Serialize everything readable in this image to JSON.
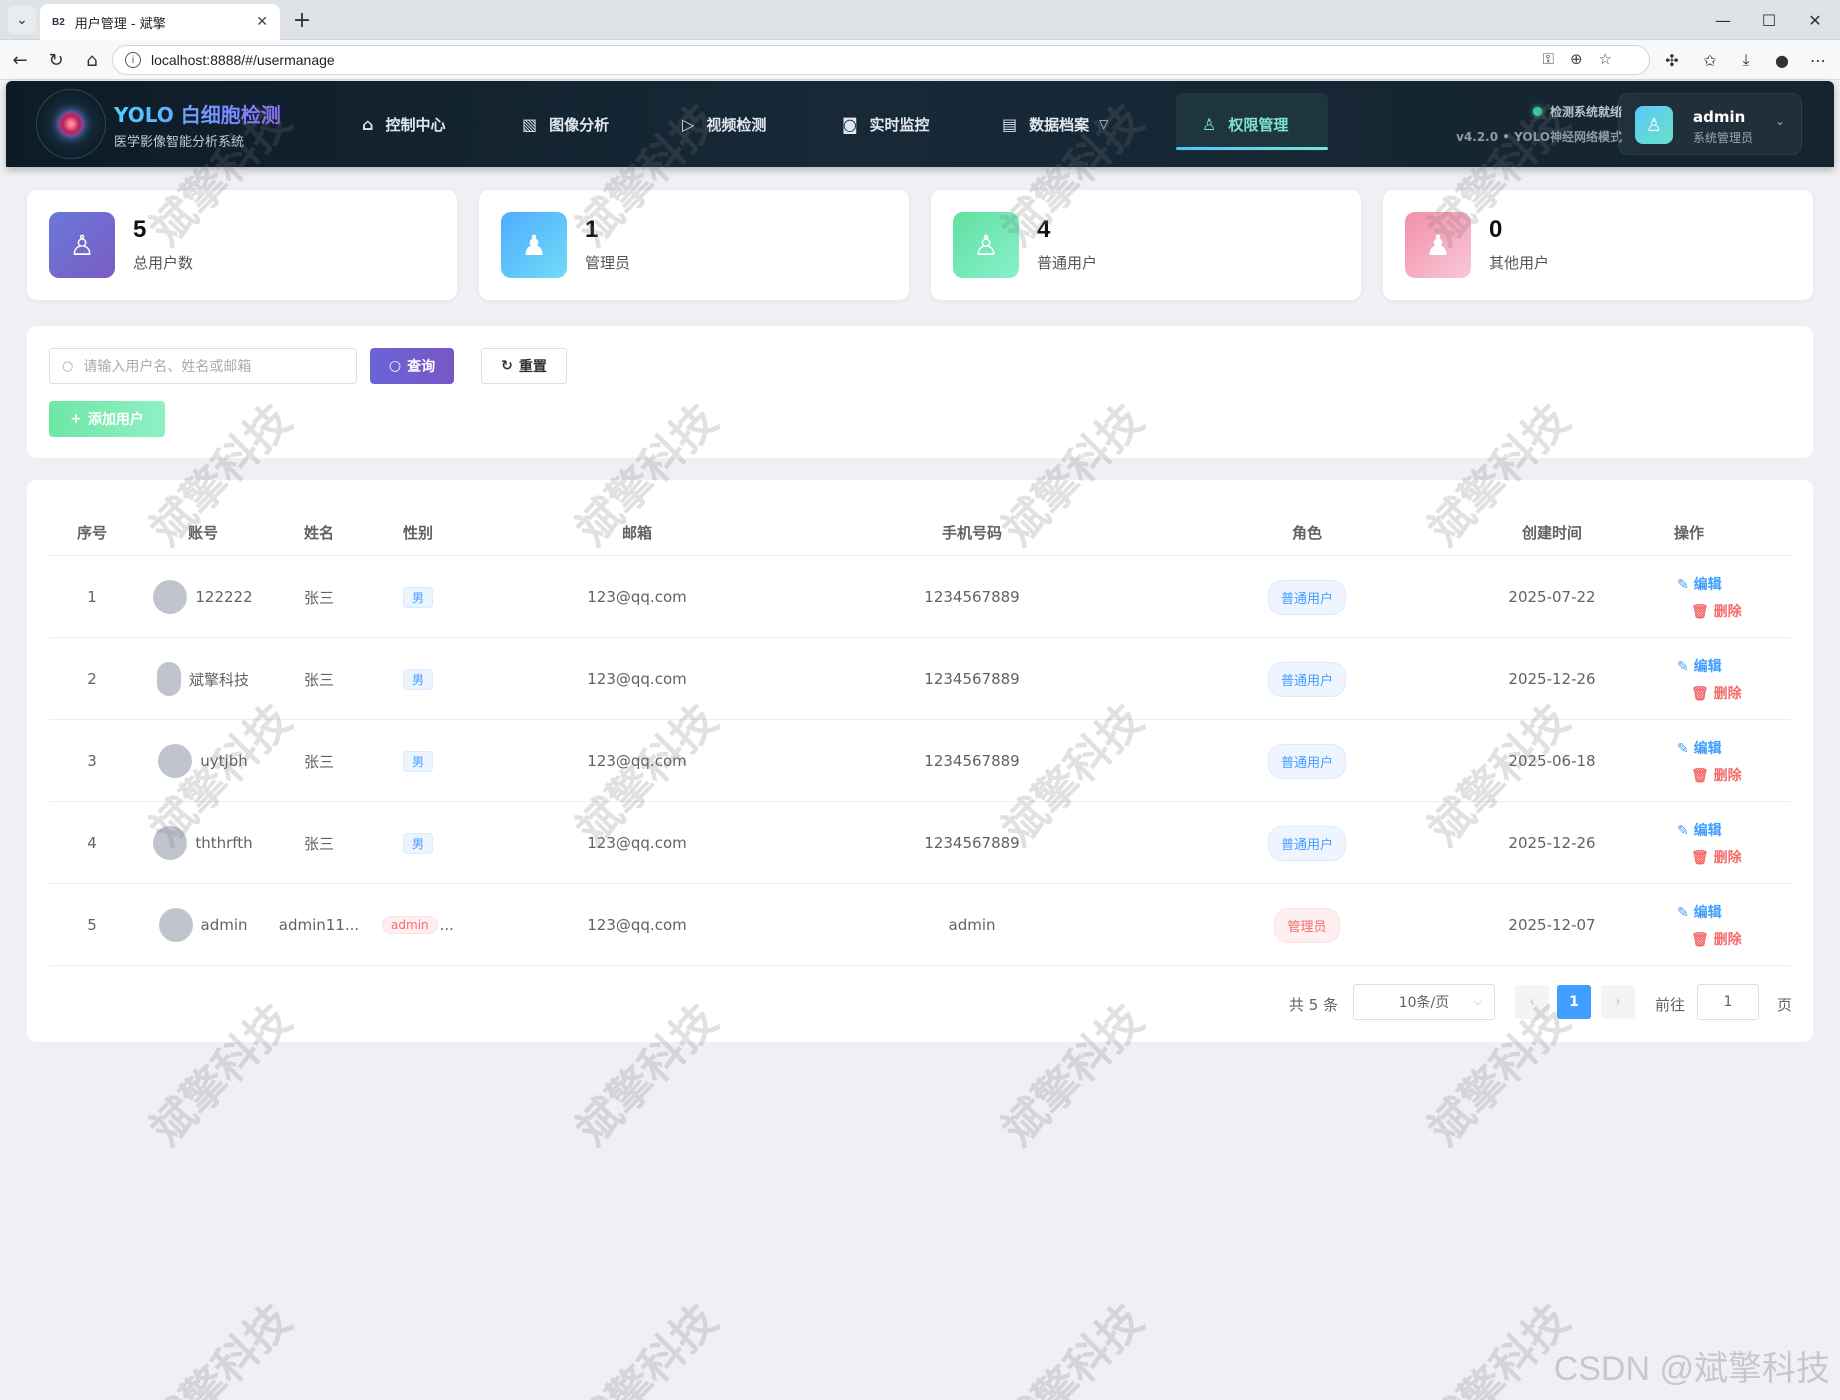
{
  "browser": {
    "tab_title": "用户管理 - 斌擎",
    "tab_favicon": "B2",
    "url": "localhost:8888/#/usermanage"
  },
  "header": {
    "brand_title": "YOLO 白细胞检测",
    "brand_subtitle": "医学影像智能分析系统",
    "nav": [
      {
        "label": "控制中心",
        "icon": "home-icon"
      },
      {
        "label": "图像分析",
        "icon": "image-icon"
      },
      {
        "label": "视频检测",
        "icon": "play-icon"
      },
      {
        "label": "实时监控",
        "icon": "camera-icon"
      },
      {
        "label": "数据档案",
        "icon": "document-icon"
      },
      {
        "label": "权限管理",
        "icon": "user-icon",
        "active": true
      }
    ],
    "status_text": "检测系统就绪",
    "version_text": "v4.2.0 • YOLO神经网络模式",
    "user_name": "admin",
    "user_role": "系统管理员"
  },
  "stats": [
    {
      "value": "5",
      "label": "总用户数",
      "color_from": "#6a78d8",
      "color_to": "#7b5bc4"
    },
    {
      "value": "1",
      "label": "管理员",
      "color_from": "#4facfe",
      "color_to": "#6fdcf7"
    },
    {
      "value": "4",
      "label": "普通用户",
      "color_from": "#5fe0a0",
      "color_to": "#89f0cc"
    },
    {
      "value": "0",
      "label": "其他用户",
      "color_from": "#f38ea8",
      "color_to": "#f7c8d8"
    }
  ],
  "search": {
    "placeholder": "请输入用户名、姓名或邮箱",
    "query_label": "查询",
    "reset_label": "重置",
    "add_label": "添加用户"
  },
  "table": {
    "headers": [
      "序号",
      "账号",
      "姓名",
      "性别",
      "邮箱",
      "手机号码",
      "角色",
      "创建时间",
      "操作"
    ],
    "edit_label": "编辑",
    "delete_label": "删除",
    "rows": [
      {
        "index": "1",
        "account": "122222",
        "name": "张三",
        "gender": "男",
        "email": "123@qq.com",
        "phone": "1234567889",
        "role": "普通用户",
        "created": "2025-07-22"
      },
      {
        "index": "2",
        "account": "斌擎科技",
        "name": "张三",
        "gender": "男",
        "email": "123@qq.com",
        "phone": "1234567889",
        "role": "普通用户",
        "created": "2025-12-26"
      },
      {
        "index": "3",
        "account": "uytjbh",
        "name": "张三",
        "gender": "男",
        "email": "123@qq.com",
        "phone": "1234567889",
        "role": "普通用户",
        "created": "2025-06-18"
      },
      {
        "index": "4",
        "account": "ththrfth",
        "name": "张三",
        "gender": "男",
        "email": "123@qq.com",
        "phone": "1234567889",
        "role": "普通用户",
        "created": "2025-12-26"
      },
      {
        "index": "5",
        "account": "admin",
        "name": "admin11...",
        "gender": "admin",
        "gender_suffix": "...",
        "email": "123@qq.com",
        "phone": "admin",
        "role": "管理员",
        "created": "2025-12-07"
      }
    ]
  },
  "pagination": {
    "total_text": "共 5 条",
    "page_size": "10条/页",
    "current_page": "1",
    "goto_label": "前往",
    "goto_value": "1",
    "page_suffix": "页"
  },
  "watermark": "斌擎科技",
  "csdn_mark": "CSDN @斌擎科技"
}
